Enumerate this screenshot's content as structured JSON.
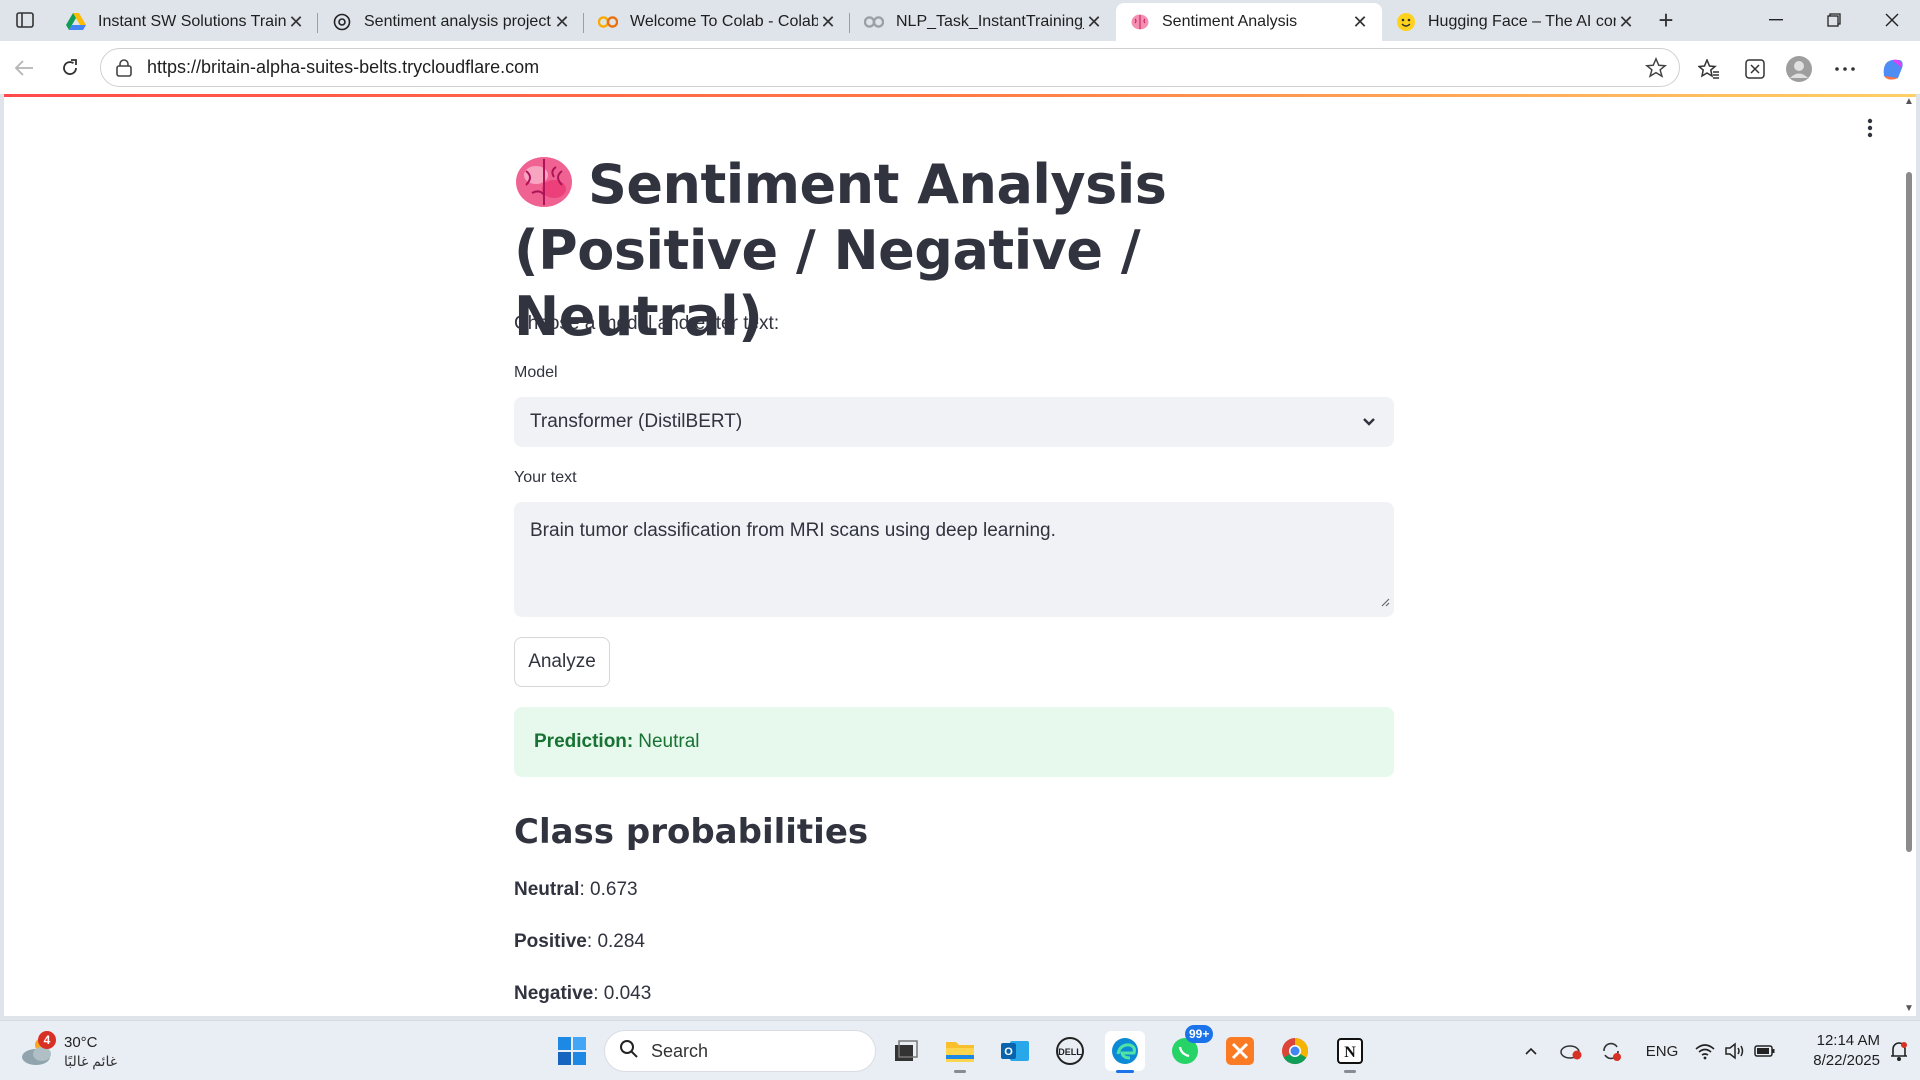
{
  "browser": {
    "tabs": [
      {
        "title": "Instant SW Solutions Training",
        "favicon": "google-drive-icon"
      },
      {
        "title": "Sentiment analysis project",
        "favicon": "chatgpt-icon"
      },
      {
        "title": "Welcome To Colab - Colab",
        "favicon": "colab-icon"
      },
      {
        "title": "NLP_Task_InstantTraining_W",
        "favicon": "colab-icon"
      },
      {
        "title": "Sentiment Analysis",
        "favicon": "brain-icon"
      },
      {
        "title": "Hugging Face – The AI comm",
        "favicon": "hugging-face-icon"
      }
    ],
    "active_tab_index": 4,
    "url": "https://britain-alpha-suites-belts.trycloudflare.com"
  },
  "page": {
    "title": "Sentiment Analysis (Positive / Negative / Neutral)",
    "title_icon": "brain-icon",
    "subtitle": "Choose a model and enter text:",
    "model_label": "Model",
    "model_value": "Transformer (DistilBERT)",
    "text_label": "Your text",
    "text_value": "Brain tumor classification from MRI scans using deep learning.",
    "analyze_label": "Analyze",
    "prediction_label": "Prediction:",
    "prediction_value": "Neutral",
    "probs_heading": "Class probabilities",
    "probabilities": [
      {
        "label": "Neutral",
        "value": "0.673"
      },
      {
        "label": "Positive",
        "value": "0.284"
      },
      {
        "label": "Negative",
        "value": "0.043"
      }
    ]
  },
  "taskbar": {
    "weather": {
      "temp": "30°C",
      "condition": "غائم غالبًا",
      "badge": "4"
    },
    "search_placeholder": "Search",
    "whatsapp_badge": "99+",
    "language": "ENG",
    "time": "12:14 AM",
    "date": "8/22/2025"
  },
  "colors": {
    "accent_line": "#ff4b4b",
    "success_bg": "#e7f9ed",
    "success_text": "#177233",
    "input_bg": "#f0f2f6",
    "text": "#31333f"
  }
}
